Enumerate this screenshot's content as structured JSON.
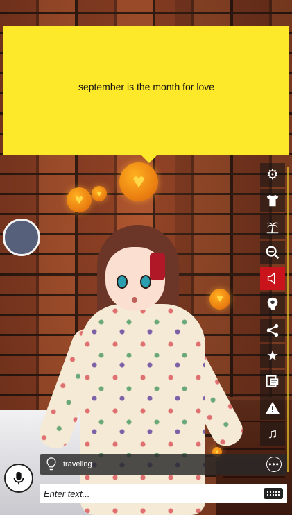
{
  "speech": {
    "text": "september is the month for love"
  },
  "toolbar": {
    "items": [
      {
        "name": "settings",
        "icon": "gear-icon"
      },
      {
        "name": "outfit",
        "icon": "shirt-icon"
      },
      {
        "name": "scene",
        "icon": "palm-tree-icon"
      },
      {
        "name": "zoom-out",
        "icon": "zoom-out-icon"
      },
      {
        "name": "sound",
        "icon": "speaker-muted-icon",
        "active": true
      },
      {
        "name": "mind",
        "icon": "head-brain-icon"
      },
      {
        "name": "share",
        "icon": "share-icon"
      },
      {
        "name": "favorite",
        "icon": "star-icon"
      },
      {
        "name": "chat-log",
        "icon": "chat-log-icon"
      },
      {
        "name": "report",
        "icon": "warning-icon"
      },
      {
        "name": "music",
        "icon": "music-note-icon"
      }
    ],
    "active_color": "#c8141a"
  },
  "suggestion": {
    "text": "traveling",
    "icon": "lightbulb-icon",
    "more_icon": "ellipsis-icon"
  },
  "input": {
    "placeholder": "Enter text...",
    "value": "",
    "keyboard_icon": "keyboard-icon"
  },
  "mic": {
    "icon": "microphone-icon"
  },
  "colors": {
    "speech_bubble": "#fde82a",
    "joystick": "#56607a"
  }
}
